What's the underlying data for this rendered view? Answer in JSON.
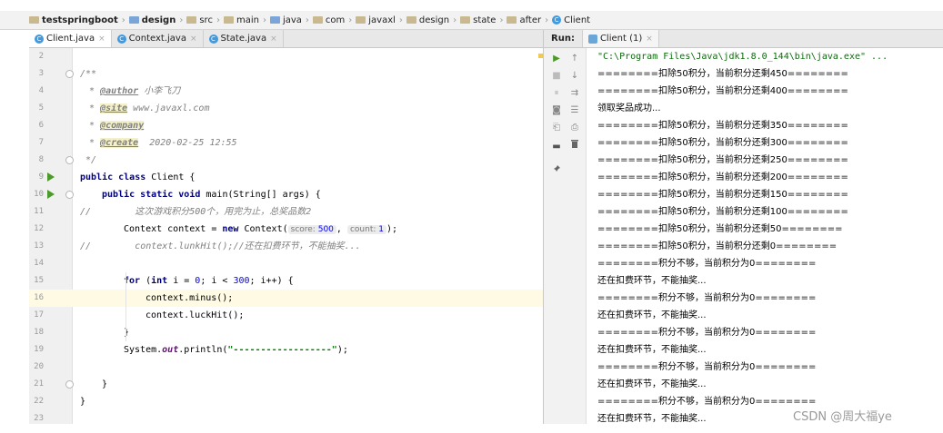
{
  "breadcrumb": [
    {
      "label": "testspringboot",
      "icon": "project-folder-icon",
      "bold": true
    },
    {
      "label": "design",
      "icon": "module-folder-icon",
      "bold": true
    },
    {
      "label": "src",
      "icon": "folder-icon"
    },
    {
      "label": "main",
      "icon": "folder-icon"
    },
    {
      "label": "java",
      "icon": "source-folder-icon"
    },
    {
      "label": "com",
      "icon": "package-folder-icon"
    },
    {
      "label": "javaxl",
      "icon": "package-folder-icon"
    },
    {
      "label": "design",
      "icon": "package-folder-icon"
    },
    {
      "label": "state",
      "icon": "package-folder-icon"
    },
    {
      "label": "after",
      "icon": "package-folder-icon"
    },
    {
      "label": "Client",
      "icon": "class-icon"
    }
  ],
  "editor_tabs": [
    {
      "label": "Client.java",
      "active": true
    },
    {
      "label": "Context.java",
      "active": false
    },
    {
      "label": "State.java",
      "active": false
    }
  ],
  "tab_close_glyph": "×",
  "code": {
    "line_numbers": [
      "2",
      "3",
      "4",
      "5",
      "6",
      "7",
      "8",
      "9",
      "10",
      "11",
      "12",
      "13",
      "14",
      "15",
      "16",
      "17",
      "18",
      "19",
      "20",
      "21",
      "22",
      "23"
    ],
    "l3": "/**",
    "l4_tag": "@author",
    "l4_text": " 小李飞刀",
    "l5_tag": "@site",
    "l5_text": " www.javaxl.com",
    "l6_tag": "@company",
    "l7_tag": "@create",
    "l7_text": "  2020-02-25 12:55",
    "l8": " */",
    "l9_kw": "public class",
    "l9_text": " Client {",
    "l10_kw": "public static void",
    "l10_text": " main(String[] args) {",
    "l11": "//        这次游戏积分500个，用完为止，总奖品数2",
    "l12_a": "Context context = ",
    "l12_kw": "new",
    "l12_b": " Context(",
    "l12_hint1": "score:",
    "l12_num1": "500",
    "l12_sep": ", ",
    "l12_hint2": "count:",
    "l12_num2": "1",
    "l12_end": ");",
    "l13": "//        context.lunkHit();//还在扣费环节，不能抽奖...",
    "l15_kw": "for",
    "l15_a": " (",
    "l15_kw2": "int",
    "l15_b": " i = ",
    "l15_n1": "0",
    "l15_c": "; i < ",
    "l15_n2": "300",
    "l15_d": "; i++) {",
    "l16": "context.minus();",
    "l17": "context.luckHit();",
    "l18": "}",
    "l19_a": "System.",
    "l19_field": "out",
    "l19_b": ".println(",
    "l19_str": "\"------------------\"",
    "l19_c": ");",
    "l21": "}",
    "l22": "}"
  },
  "run_panel": {
    "label": "Run:",
    "tab": "Client (1)"
  },
  "console_lines": [
    "\"C:\\Program Files\\Java\\jdk1.8.0_144\\bin\\java.exe\" ...",
    "========扣除50积分，当前积分还剩450========",
    "========扣除50积分，当前积分还剩400========",
    "领取奖品成功...",
    "========扣除50积分，当前积分还剩350========",
    "========扣除50积分，当前积分还剩300========",
    "========扣除50积分，当前积分还剩250========",
    "========扣除50积分，当前积分还剩200========",
    "========扣除50积分，当前积分还剩150========",
    "========扣除50积分，当前积分还剩100========",
    "========扣除50积分，当前积分还剩50========",
    "========扣除50积分，当前积分还剩0========",
    "========积分不够，当前积分为0========",
    "还在扣费环节，不能抽奖...",
    "========积分不够，当前积分为0========",
    "还在扣费环节，不能抽奖...",
    "========积分不够，当前积分为0========",
    "还在扣费环节，不能抽奖...",
    "========积分不够，当前积分为0========",
    "还在扣费环节，不能抽奖...",
    "========积分不够，当前积分为0========",
    "还在扣费环节，不能抽奖..."
  ],
  "toolbar_icons": [
    "rerun-icon",
    "scroll-up-icon",
    "stop-icon",
    "scroll-down-icon",
    "pause-icon",
    "soft-wrap-icon",
    "camera-icon",
    "sort-icon",
    "restore-icon",
    "print-icon",
    "layout-icon",
    "delete-icon",
    "pin-icon"
  ],
  "toolbar_glyphs": {
    "rerun": "▶",
    "up": "↑",
    "stop": "■",
    "down": "↓",
    "pause": "⏸",
    "wrap": "⇉",
    "camera": "◙",
    "sort": "☰",
    "restore": "⎗",
    "print": "⎙",
    "layout": "▬",
    "delete": "🗑",
    "pin": "📌"
  },
  "watermark": "CSDN @周大福ye",
  "colors": {
    "keyword": "#000080",
    "number": "#0000ff",
    "string": "#008000",
    "comment": "#808080",
    "run_green": "#4c9a2a"
  }
}
